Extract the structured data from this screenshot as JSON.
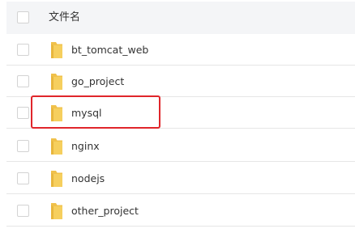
{
  "header": {
    "column_name": "文件名"
  },
  "files": [
    {
      "name": "bt_tomcat_web",
      "icon": "folder-icon"
    },
    {
      "name": "go_project",
      "icon": "folder-icon"
    },
    {
      "name": "mysql",
      "icon": "folder-icon"
    },
    {
      "name": "nginx",
      "icon": "folder-icon"
    },
    {
      "name": "nodejs",
      "icon": "folder-icon"
    },
    {
      "name": "other_project",
      "icon": "folder-icon"
    }
  ],
  "highlighted_file": "mysql",
  "colors": {
    "folder_body": "#f6cf5e",
    "folder_front": "#fbe08a",
    "highlight": "#e0262b",
    "header_bg": "#f4f5f7"
  }
}
